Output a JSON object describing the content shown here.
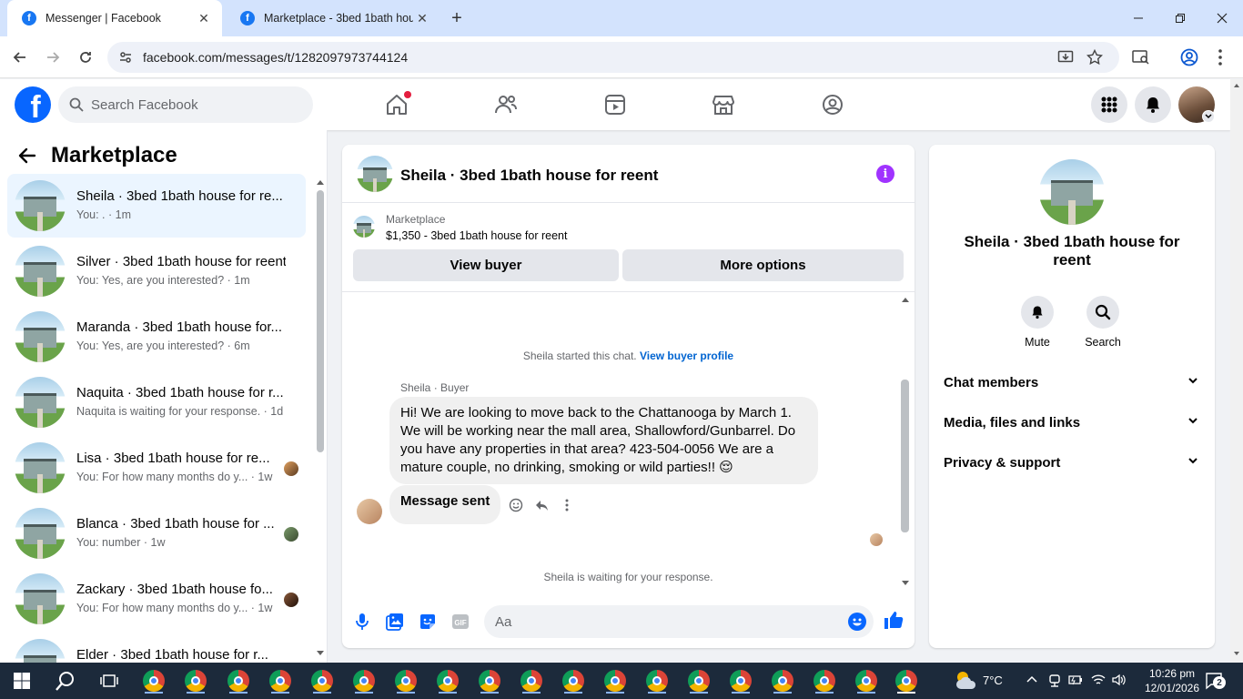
{
  "browser": {
    "tabs": [
      {
        "title": "Messenger | Facebook",
        "active": true
      },
      {
        "title": "Marketplace - 3bed 1bath hous",
        "active": false
      }
    ],
    "url": "facebook.com/messages/t/1282097973744124"
  },
  "header": {
    "search_placeholder": "Search Facebook"
  },
  "sidebar": {
    "title": "Marketplace",
    "conversations": [
      {
        "name": "Sheila · 3bed 1bath house for re...",
        "preview": "You: . · 1m",
        "selected": true
      },
      {
        "name": "Silver · 3bed 1bath house for reent",
        "preview": "You: Yes, are you interested? · 1m"
      },
      {
        "name": "Maranda · 3bed 1bath house for...",
        "preview": "You: Yes, are you interested? · 6m"
      },
      {
        "name": "Naquita · 3bed 1bath house for r...",
        "preview": "Naquita is waiting for your response. · 1d"
      },
      {
        "name": "Lisa · 3bed 1bath house for re...",
        "preview": "You: For how many months do y... · 1w"
      },
      {
        "name": "Blanca · 3bed 1bath house for ...",
        "preview": "You: number · 1w"
      },
      {
        "name": "Zackary · 3bed 1bath house fo...",
        "preview": "You: For how many months do y... · 1w"
      },
      {
        "name": "Elder · 3bed 1bath house for r...",
        "preview": ""
      }
    ]
  },
  "chat": {
    "title": "Sheila · 3bed 1bath house for reent",
    "marketplace_label": "Marketplace",
    "listing": "$1,350 - 3bed 1bath house for reent",
    "view_buyer": "View buyer",
    "more_options": "More options",
    "started_text": "Sheila started this chat.",
    "view_buyer_profile": "View buyer profile",
    "sender_label": "Sheila · Buyer",
    "message": "Hi! We are looking to move back to the Chattanooga by March 1. We will be working near the mall area, Shallowford/Gunbarrel. Do you have any properties in that area? 423-504-0056 We are a mature couple, no drinking, smoking or wild parties!! 😌",
    "message_sent": "Message sent",
    "waiting_text": "Sheila is waiting for your response.",
    "input_placeholder": "Aa"
  },
  "details": {
    "name": "Sheila · 3bed 1bath house for reent",
    "mute": "Mute",
    "search": "Search",
    "sections": [
      "Chat members",
      "Media, files and links",
      "Privacy & support"
    ]
  },
  "taskbar": {
    "weather": "7°C",
    "time": "10:26 pm",
    "date": "12/01/2026",
    "notifications": "2"
  },
  "colors": {
    "fb_blue": "#0866ff",
    "accent_purple": "#a033ff",
    "selected_bg": "#ebf5ff",
    "link_blue": "#0064d1"
  }
}
